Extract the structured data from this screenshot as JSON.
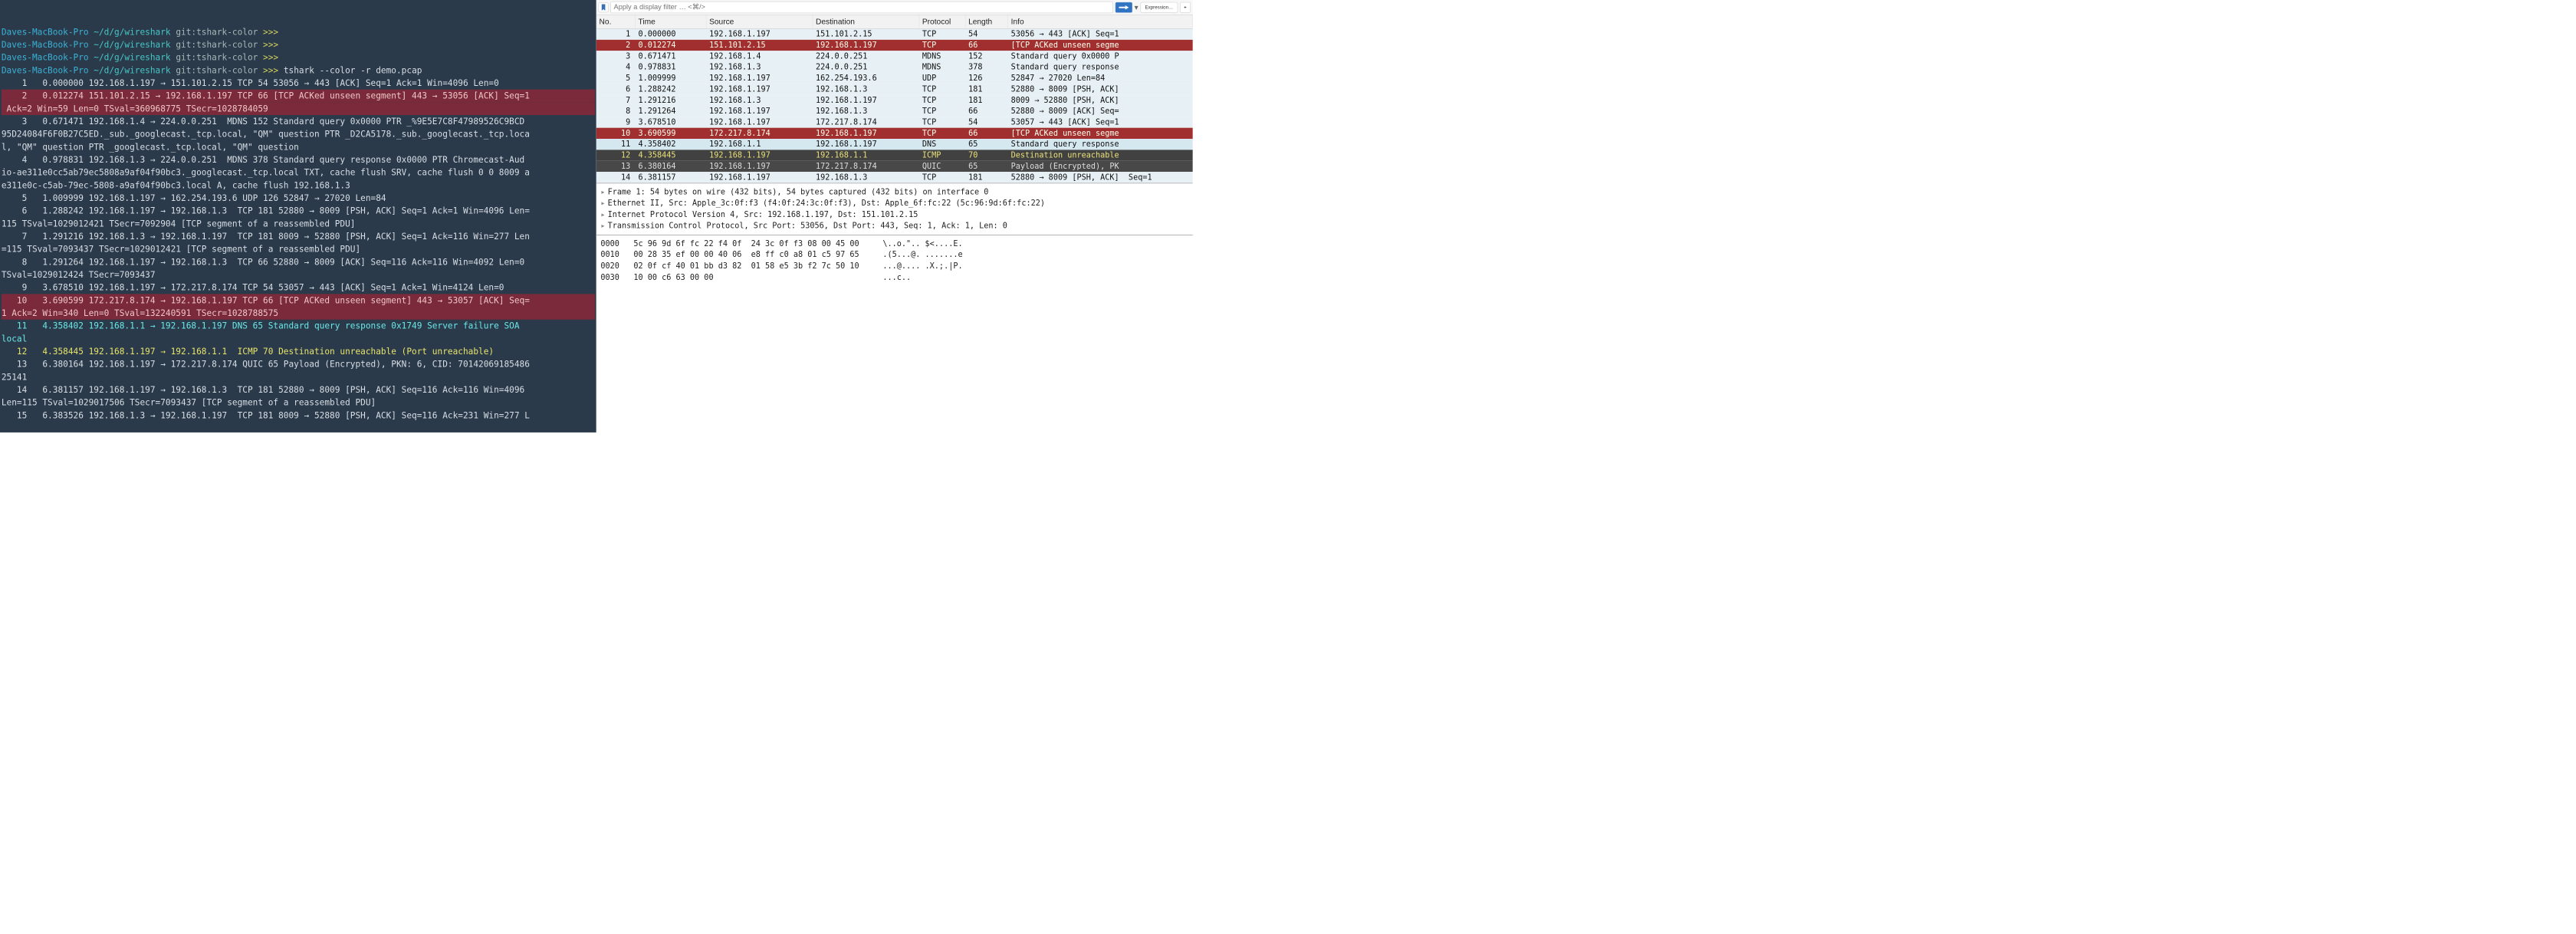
{
  "terminal": {
    "host": "Daves-MacBook-Pro",
    "path": "~/d/g/wireshark",
    "gitStr": "git:",
    "branch": "tshark-color",
    "arrows": ">>>",
    "command": "tshark --color -r demo.pcap",
    "lines": [
      {
        "cls": "",
        "txt": "    1   0.000000 192.168.1.197 → 151.101.2.15 TCP 54 53056 → 443 [ACK] Seq=1 Ack=1 Win=4096 Len=0"
      },
      {
        "cls": "t-red",
        "txt": "    2   0.012274 151.101.2.15 → 192.168.1.197 TCP 66 [TCP ACKed unseen segment] 443 → 53056 [ACK] Seq=1"
      },
      {
        "cls": "t-red",
        "txt": " Ack=2 Win=59 Len=0 TSval=360968775 TSecr=1028784059"
      },
      {
        "cls": "",
        "txt": "    3   0.671471 192.168.1.4 → 224.0.0.251  MDNS 152 Standard query 0x0000 PTR _%9E5E7C8F47989526C9BCD"
      },
      {
        "cls": "",
        "txt": "95D24084F6F0B27C5ED._sub._googlecast._tcp.local, \"QM\" question PTR _D2CA5178._sub._googlecast._tcp.loca"
      },
      {
        "cls": "",
        "txt": "l, \"QM\" question PTR _googlecast._tcp.local, \"QM\" question"
      },
      {
        "cls": "",
        "txt": "    4   0.978831 192.168.1.3 → 224.0.0.251  MDNS 378 Standard query response 0x0000 PTR Chromecast-Aud"
      },
      {
        "cls": "",
        "txt": "io-ae311e0cc5ab79ec5808a9af04f90bc3._googlecast._tcp.local TXT, cache flush SRV, cache flush 0 0 8009 a"
      },
      {
        "cls": "",
        "txt": "e311e0c-c5ab-79ec-5808-a9af04f90bc3.local A, cache flush 192.168.1.3"
      },
      {
        "cls": "",
        "txt": "    5   1.009999 192.168.1.197 → 162.254.193.6 UDP 126 52847 → 27020 Len=84"
      },
      {
        "cls": "",
        "txt": "    6   1.288242 192.168.1.197 → 192.168.1.3  TCP 181 52880 → 8009 [PSH, ACK] Seq=1 Ack=1 Win=4096 Len="
      },
      {
        "cls": "",
        "txt": "115 TSval=1029012421 TSecr=7092904 [TCP segment of a reassembled PDU]"
      },
      {
        "cls": "",
        "txt": "    7   1.291216 192.168.1.3 → 192.168.1.197  TCP 181 8009 → 52880 [PSH, ACK] Seq=1 Ack=116 Win=277 Len"
      },
      {
        "cls": "",
        "txt": "=115 TSval=7093437 TSecr=1029012421 [TCP segment of a reassembled PDU]"
      },
      {
        "cls": "",
        "txt": "    8   1.291264 192.168.1.197 → 192.168.1.3  TCP 66 52880 → 8009 [ACK] Seq=116 Ack=116 Win=4092 Len=0 "
      },
      {
        "cls": "",
        "txt": "TSval=1029012424 TSecr=7093437"
      },
      {
        "cls": "",
        "txt": "    9   3.678510 192.168.1.197 → 172.217.8.174 TCP 54 53057 → 443 [ACK] Seq=1 Ack=1 Win=4124 Len=0"
      },
      {
        "cls": "t-red",
        "txt": "   10   3.690599 172.217.8.174 → 192.168.1.197 TCP 66 [TCP ACKed unseen segment] 443 → 53057 [ACK] Seq="
      },
      {
        "cls": "t-red",
        "txt": "1 Ack=2 Win=340 Len=0 TSval=132240591 TSecr=1028788575"
      },
      {
        "cls": "t-cyan",
        "txt": "   11   4.358402 192.168.1.1 → 192.168.1.197 DNS 65 Standard query response 0x1749 Server failure SOA "
      },
      {
        "cls": "t-cyan",
        "txt": "local"
      },
      {
        "cls": "t-yellow",
        "txt": "   12   4.358445 192.168.1.197 → 192.168.1.1  ICMP 70 Destination unreachable (Port unreachable)"
      },
      {
        "cls": "",
        "txt": "   13   6.380164 192.168.1.197 → 172.217.8.174 QUIC 65 Payload (Encrypted), PKN: 6, CID: 70142069185486"
      },
      {
        "cls": "",
        "txt": "25141"
      },
      {
        "cls": "",
        "txt": "   14   6.381157 192.168.1.197 → 192.168.1.3  TCP 181 52880 → 8009 [PSH, ACK] Seq=116 Ack=116 Win=4096 "
      },
      {
        "cls": "",
        "txt": "Len=115 TSval=1029017506 TSecr=7093437 [TCP segment of a reassembled PDU]"
      },
      {
        "cls": "",
        "txt": "   15   6.383526 192.168.1.3 → 192.168.1.197  TCP 181 8009 → 52880 [PSH, ACK] Seq=116 Ack=231 Win=277 L"
      }
    ]
  },
  "wireshark": {
    "filterPlaceholder": "Apply a display filter … <⌘/>",
    "expressionLabel": "Expression…",
    "headers": [
      "No.",
      "Time",
      "Source",
      "Destination",
      "Protocol",
      "Length",
      "Info"
    ],
    "rows": [
      {
        "cls": "normal",
        "num": "1",
        "time": "0.000000",
        "src": "192.168.1.197",
        "dst": "151.101.2.15",
        "proto": "TCP",
        "len": "54",
        "info": "53056 → 443 [ACK] Seq=1"
      },
      {
        "cls": "red",
        "num": "2",
        "time": "0.012274",
        "src": "151.101.2.15",
        "dst": "192.168.1.197",
        "proto": "TCP",
        "len": "66",
        "info": "[TCP ACKed unseen segme"
      },
      {
        "cls": "normal",
        "num": "3",
        "time": "0.671471",
        "src": "192.168.1.4",
        "dst": "224.0.0.251",
        "proto": "MDNS",
        "len": "152",
        "info": "Standard query 0x0000 P"
      },
      {
        "cls": "normal",
        "num": "4",
        "time": "0.978831",
        "src": "192.168.1.3",
        "dst": "224.0.0.251",
        "proto": "MDNS",
        "len": "378",
        "info": "Standard query response"
      },
      {
        "cls": "normal",
        "num": "5",
        "time": "1.009999",
        "src": "192.168.1.197",
        "dst": "162.254.193.6",
        "proto": "UDP",
        "len": "126",
        "info": "52847 → 27020 Len=84"
      },
      {
        "cls": "normal",
        "num": "6",
        "time": "1.288242",
        "src": "192.168.1.197",
        "dst": "192.168.1.3",
        "proto": "TCP",
        "len": "181",
        "info": "52880 → 8009 [PSH, ACK]"
      },
      {
        "cls": "normal",
        "num": "7",
        "time": "1.291216",
        "src": "192.168.1.3",
        "dst": "192.168.1.197",
        "proto": "TCP",
        "len": "181",
        "info": "8009 → 52880 [PSH, ACK]"
      },
      {
        "cls": "normal",
        "num": "8",
        "time": "1.291264",
        "src": "192.168.1.197",
        "dst": "192.168.1.3",
        "proto": "TCP",
        "len": "66",
        "info": "52880 → 8009 [ACK] Seq="
      },
      {
        "cls": "normal",
        "num": "9",
        "time": "3.678510",
        "src": "192.168.1.197",
        "dst": "172.217.8.174",
        "proto": "TCP",
        "len": "54",
        "info": "53057 → 443 [ACK] Seq=1"
      },
      {
        "cls": "red",
        "num": "10",
        "time": "3.690599",
        "src": "172.217.8.174",
        "dst": "192.168.1.197",
        "proto": "TCP",
        "len": "66",
        "info": "[TCP ACKed unseen segme"
      },
      {
        "cls": "lite",
        "num": "11",
        "time": "4.358402",
        "src": "192.168.1.1",
        "dst": "192.168.1.197",
        "proto": "DNS",
        "len": "65",
        "info": "Standard query response"
      },
      {
        "cls": "grey",
        "num": "12",
        "time": "4.358445",
        "src": "192.168.1.197",
        "dst": "192.168.1.1",
        "proto": "ICMP",
        "len": "70",
        "info": "Destination unreachable"
      },
      {
        "cls": "grey2",
        "num": "13",
        "time": "6.380164",
        "src": "192.168.1.197",
        "dst": "172.217.8.174",
        "proto": "QUIC",
        "len": "65",
        "info": "Payload (Encrypted), PK"
      },
      {
        "cls": "normal",
        "num": "14",
        "time": "6.381157",
        "src": "192.168.1.197",
        "dst": "192.168.1.3",
        "proto": "TCP",
        "len": "181",
        "info": "52880 → 8009 [PSH, ACK]"
      }
    ],
    "extraInfo": "Seq=1",
    "details": [
      "Frame 1: 54 bytes on wire (432 bits), 54 bytes captured (432 bits) on interface 0",
      "Ethernet II, Src: Apple_3c:0f:f3 (f4:0f:24:3c:0f:f3), Dst: Apple_6f:fc:22 (5c:96:9d:6f:fc:22)",
      "Internet Protocol Version 4, Src: 192.168.1.197, Dst: 151.101.2.15",
      "Transmission Control Protocol, Src Port: 53056, Dst Port: 443, Seq: 1, Ack: 1, Len: 0"
    ],
    "hex": [
      {
        "off": "0000",
        "b": "5c 96 9d 6f fc 22 f4 0f  24 3c 0f f3 08 00 45 00",
        "a": "\\..o.\".. $<....E."
      },
      {
        "off": "0010",
        "b": "00 28 35 ef 00 00 40 06  e8 ff c0 a8 01 c5 97 65",
        "a": ".(5...@. .......e"
      },
      {
        "off": "0020",
        "b": "02 0f cf 40 01 bb d3 82  01 58 e5 3b f2 7c 50 10",
        "a": "...@.... .X.;.|P."
      },
      {
        "off": "0030",
        "b": "10 00 c6 63 00 00",
        "a": "...c.."
      }
    ]
  }
}
